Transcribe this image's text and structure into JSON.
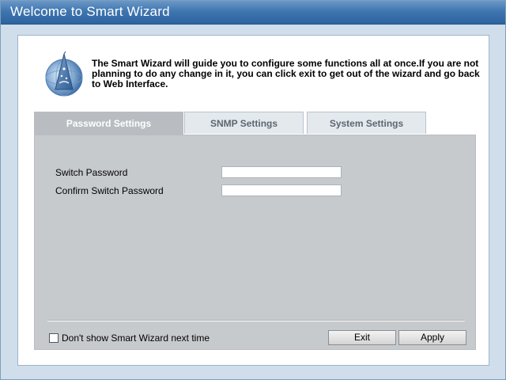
{
  "window": {
    "title": "Welcome to Smart Wizard"
  },
  "intro": {
    "icon": "wizard-hat-icon",
    "text": "The Smart Wizard will guide you to configure some functions all at once.If you are not planning to do any change in it, you can click exit to get out of the wizard and go back to Web Interface."
  },
  "tabs": [
    {
      "label": "Password Settings",
      "active": true
    },
    {
      "label": "SNMP Settings",
      "active": false
    },
    {
      "label": "System Settings",
      "active": false
    }
  ],
  "form": {
    "switch_password_label": "Switch Password",
    "switch_password_value": "",
    "confirm_password_label": "Confirm Switch Password",
    "confirm_password_value": ""
  },
  "footer": {
    "dont_show_label": "Don't show Smart Wizard next time",
    "dont_show_checked": false,
    "exit_label": "Exit",
    "apply_label": "Apply"
  },
  "colors": {
    "titlebar": "#3f76b0",
    "active_tab": "#b9bdc2",
    "tab_body": "#c7cacd"
  }
}
